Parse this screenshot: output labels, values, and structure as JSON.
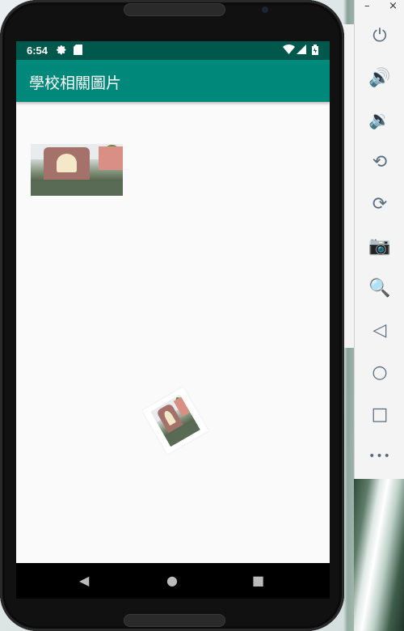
{
  "status_bar": {
    "time": "6:54",
    "icons": [
      "gear-icon",
      "sd-card-icon",
      "wifi-icon",
      "signal-icon",
      "battery-icon"
    ]
  },
  "app_bar": {
    "title": "學校相關圖片"
  },
  "images": [
    {
      "name": "school-pavilion-photo",
      "rotation_deg": 0
    },
    {
      "name": "school-pavilion-photo-rotated",
      "rotation_deg": -30
    }
  ],
  "nav_bar": {
    "back": "◀",
    "home": "●",
    "recents": "■"
  },
  "emulator_toolbar": {
    "window_controls": {
      "minimize": "–",
      "close": "×"
    },
    "buttons": [
      {
        "name": "power-button",
        "icon": "power-icon",
        "glyph": "⏻"
      },
      {
        "name": "volume-up-button",
        "icon": "volume-up-icon",
        "glyph": "🔊"
      },
      {
        "name": "volume-down-button",
        "icon": "volume-down-icon",
        "glyph": "🔉"
      },
      {
        "name": "rotate-left-button",
        "icon": "rotate-left-icon",
        "glyph": "⟲"
      },
      {
        "name": "rotate-right-button",
        "icon": "rotate-right-icon",
        "glyph": "⟳"
      },
      {
        "name": "screenshot-button",
        "icon": "camera-icon",
        "glyph": "📷"
      },
      {
        "name": "zoom-button",
        "icon": "zoom-icon",
        "glyph": "🔍"
      },
      {
        "name": "back-button",
        "icon": "back-triangle-icon",
        "glyph": "◁"
      },
      {
        "name": "home-button",
        "icon": "home-circle-icon",
        "glyph": "○"
      },
      {
        "name": "overview-button",
        "icon": "overview-square-icon",
        "glyph": "□"
      },
      {
        "name": "more-button",
        "icon": "more-dots-icon",
        "glyph": "•••"
      }
    ]
  },
  "colors": {
    "status_bar": "#00574b",
    "app_bar": "#00897b",
    "screen_background": "#fafafa",
    "toolbar_icon": "#586d7d"
  }
}
